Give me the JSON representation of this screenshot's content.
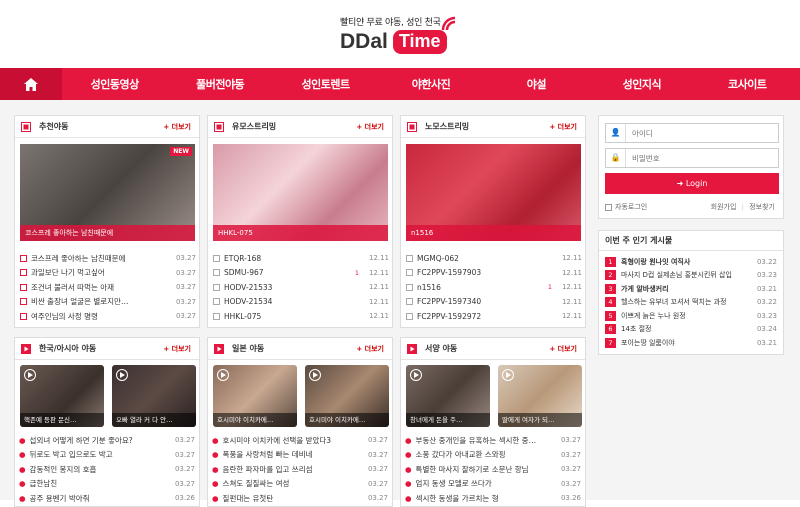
{
  "header": {
    "slogan": "빨티얀 무료 야동, 성인 천국",
    "logo_left": "DDal",
    "logo_right": "Time"
  },
  "nav": {
    "home_icon": "home-icon",
    "items": [
      "성인동영상",
      "풀버전야동",
      "성인토렌트",
      "야한사진",
      "야설",
      "성인지식",
      "코사이트"
    ]
  },
  "panels": {
    "recommend": {
      "title": "추천야동",
      "more": "+ 더보기",
      "badge": "NEW",
      "thumb_caption": "코스프레 좋아하는 남친때문에",
      "rows": [
        {
          "text": "코스프레 좋아하는 남친때문에",
          "count": "",
          "date": "03.27"
        },
        {
          "text": "과일보단 나기 먹고싶어",
          "count": "",
          "date": "03.27"
        },
        {
          "text": "조건녀 불러서 따먹는 아재",
          "count": "",
          "date": "03.27"
        },
        {
          "text": "비싼 출장녀 얼굴은 별로지만…",
          "count": "",
          "date": "03.27"
        },
        {
          "text": "여주인님의 사정 명령",
          "count": "",
          "date": "03.27"
        }
      ]
    },
    "censored": {
      "title": "유모스트리밍",
      "more": "+ 더보기",
      "thumb_caption": "HHKL-075",
      "rows": [
        {
          "text": "ETQR-168",
          "count": "",
          "date": "12.11"
        },
        {
          "text": "SDMU-967",
          "count": "1",
          "date": "12.11"
        },
        {
          "text": "HODV-21533",
          "count": "",
          "date": "12.11"
        },
        {
          "text": "HODV-21534",
          "count": "",
          "date": "12.11"
        },
        {
          "text": "HHKL-075",
          "count": "",
          "date": "12.11"
        }
      ]
    },
    "uncensored": {
      "title": "노모스트리밍",
      "more": "+ 더보기",
      "thumb_caption": "n1516",
      "rows": [
        {
          "text": "MGMQ-062",
          "count": "",
          "date": "12.11"
        },
        {
          "text": "FC2PPV-1597903",
          "count": "",
          "date": "12.11"
        },
        {
          "text": "n1516",
          "count": "1",
          "date": "12.11"
        },
        {
          "text": "FC2PPV-1597340",
          "count": "",
          "date": "12.11"
        },
        {
          "text": "FC2PPV-1592972",
          "count": "",
          "date": "12.11"
        }
      ]
    },
    "korean": {
      "title": "한국/아시아 야동",
      "more": "+ 더보기",
      "thumbs": [
        "핵존예 등판 문신…",
        "오빠 열라 커 다 안…"
      ],
      "rows": [
        {
          "text": "섭외녀 어떻게 하면 기분 좋아요?",
          "date": "03.27"
        },
        {
          "text": "뒤로도 박고 입으로도 박고",
          "date": "03.27"
        },
        {
          "text": "감동적인 봉지의 호흡",
          "date": "03.27"
        },
        {
          "text": "급한남친",
          "date": "03.27"
        },
        {
          "text": "공주 용벤기 박아줘",
          "date": "03.26"
        }
      ]
    },
    "japanese": {
      "title": "일본 야동",
      "more": "+ 더보기",
      "thumbs": [
        "호시미야 이치카에…",
        "호시미야 이치카에…"
      ],
      "rows": [
        {
          "text": "호시미야 이치카에 선택을 받았다3",
          "date": "03.27"
        },
        {
          "text": "폭풍을 사랑처럼 빠는 데비네",
          "date": "03.27"
        },
        {
          "text": "음란한 파자마를 입고 쓰리섬",
          "date": "03.27"
        },
        {
          "text": "스쳐도 질질싸는 여성",
          "date": "03.27"
        },
        {
          "text": "질펀대는 유첫탄",
          "date": "03.27"
        }
      ]
    },
    "western": {
      "title": "서양 야동",
      "more": "+ 더보기",
      "thumbs": [
        "창녀에게 돈을 주…",
        "딸에게 여자가 되…"
      ],
      "rows": [
        {
          "text": "부동산 중개인을 유혹하는 섹시한 중…",
          "date": "03.27"
        },
        {
          "text": "소풍 갔다가 아내교환 스와핑",
          "date": "03.27"
        },
        {
          "text": "특별한 마사지 잘하기로 소문난 항님",
          "date": "03.27"
        },
        {
          "text": "엄지 동생 모델로 쓰다가",
          "date": "03.27"
        },
        {
          "text": "섹시한 동생을 가르치는 형",
          "date": "03.26"
        }
      ]
    }
  },
  "login": {
    "id_placeholder": "아이디",
    "pw_placeholder": "비밀번호",
    "button": "Login",
    "auto_login": "자동로그인",
    "join": "회원가입",
    "find": "정보찾기"
  },
  "popular": {
    "title": "이번 주 인기 게시물",
    "items": [
      {
        "rank": "1",
        "text": "흑형이랑 원나잇 여직사",
        "date": "03.22"
      },
      {
        "rank": "2",
        "text": "마사지 D컵 실제손님 홍분시킨뒤 삽입",
        "date": "03.23"
      },
      {
        "rank": "3",
        "text": "가게 알바생커리",
        "date": "03.21"
      },
      {
        "rank": "4",
        "text": "헬스하는 유부녀 꼬셔서 떡치는 과정",
        "date": "03.22"
      },
      {
        "rank": "5",
        "text": "이쁘게 늙은 누나 원정",
        "date": "03.23"
      },
      {
        "rank": "6",
        "text": "14초 절정",
        "date": "03.24"
      },
      {
        "rank": "7",
        "text": "포이는땅 일룸이야",
        "date": "03.21"
      }
    ]
  }
}
